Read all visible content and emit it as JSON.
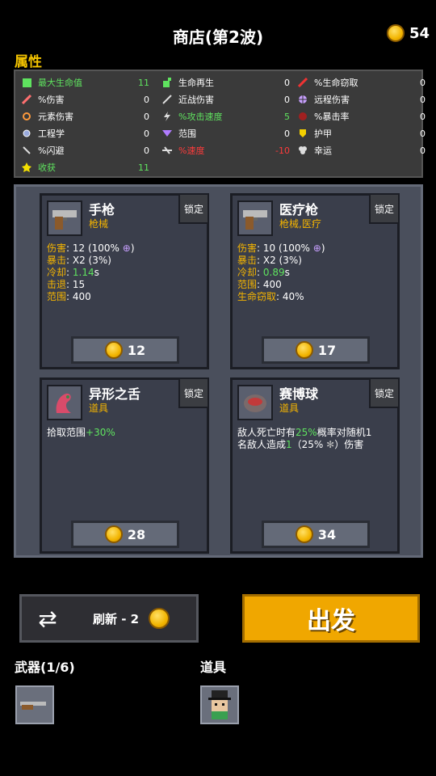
{
  "header": {
    "title": "商店(第2波)",
    "coins": "54"
  },
  "attributes": {
    "title": "属性",
    "stats": [
      {
        "name": "最大生命值",
        "value": "11",
        "color": "green",
        "icon": "heart-icon"
      },
      {
        "name": "%伤害",
        "value": "0",
        "color": "white",
        "icon": "damage-icon"
      },
      {
        "name": "元素伤害",
        "value": "0",
        "color": "white",
        "icon": "element-icon"
      },
      {
        "name": "工程学",
        "value": "0",
        "color": "white",
        "icon": "gear-icon"
      },
      {
        "name": "%闪避",
        "value": "0",
        "color": "white",
        "icon": "dodge-icon"
      },
      {
        "name": "收获",
        "value": "11",
        "color": "green",
        "icon": "harvest-icon"
      },
      {
        "name": "生命再生",
        "value": "0",
        "color": "white",
        "icon": "regen-icon"
      },
      {
        "name": "近战伤害",
        "value": "0",
        "color": "white",
        "icon": "melee-icon"
      },
      {
        "name": "%攻击速度",
        "value": "5",
        "color": "green",
        "icon": "attack-speed-icon"
      },
      {
        "name": "范围",
        "value": "0",
        "color": "white",
        "icon": "range-icon"
      },
      {
        "name": "%速度",
        "value": "-10",
        "color": "red",
        "icon": "speed-icon"
      },
      {
        "name": "%生命窃取",
        "value": "0",
        "color": "white",
        "icon": "lifesteal-icon"
      },
      {
        "name": "远程伤害",
        "value": "0",
        "color": "white",
        "icon": "ranged-icon"
      },
      {
        "name": "%暴击率",
        "value": "0",
        "color": "white",
        "icon": "crit-icon"
      },
      {
        "name": "护甲",
        "value": "0",
        "color": "white",
        "icon": "armor-icon"
      },
      {
        "name": "幸运",
        "value": "0",
        "color": "white",
        "icon": "luck-icon"
      }
    ]
  },
  "shop": {
    "lock_label": "锁定",
    "items": [
      {
        "name": "手枪",
        "type": "枪械",
        "price": "12",
        "icon": "pistol-icon",
        "lines": [
          {
            "key": "伤害",
            "value": ": 12 (100%",
            "suffix_icon": "crosshair-icon",
            "suffix": ")"
          },
          {
            "key": "暴击",
            "value": ": X2 (3%)"
          },
          {
            "key": "冷却",
            "value_green": "1.14",
            "value": "s",
            "sep": ": "
          },
          {
            "key": "击退",
            "value": ": 15"
          },
          {
            "key": "范围",
            "value": ": 400"
          }
        ]
      },
      {
        "name": "医疗枪",
        "type": "枪械,医疗",
        "price": "17",
        "icon": "medical-gun-icon",
        "lines": [
          {
            "key": "伤害",
            "value": ": 10 (100%",
            "suffix_icon": "crosshair-icon",
            "suffix": ")"
          },
          {
            "key": "暴击",
            "value": ": X2 (3%)"
          },
          {
            "key": "冷却",
            "value_green": "0.89",
            "value": "s",
            "sep": ": "
          },
          {
            "key": "范围",
            "value": ": 400"
          },
          {
            "key": "生命窃取",
            "value": ": 40%"
          }
        ]
      },
      {
        "name": "异形之舌",
        "type": "道具",
        "price": "28",
        "icon": "alien-tongue-icon",
        "desc_a": "拾取范围",
        "desc_green": "+30%"
      },
      {
        "name": "赛博球",
        "type": "道具",
        "price": "34",
        "icon": "cyberball-icon",
        "desc_a": "敌人死亡时有",
        "desc_green": "25%",
        "desc_b": "概率对随机1",
        "desc_c": "名敌人造成",
        "desc_green2": "1",
        "desc_d": "（25%",
        "desc_e": "）伤害"
      }
    ]
  },
  "actions": {
    "refresh_label": "刷新 - 2",
    "go_label": "出发"
  },
  "inventory": {
    "weapons_label": "武器(1/6)",
    "items_label": "道具"
  },
  "colors": {
    "gold": "#f4b400",
    "green": "#5fe35f",
    "red": "#ff3b3b",
    "go_button": "#f0a700"
  }
}
